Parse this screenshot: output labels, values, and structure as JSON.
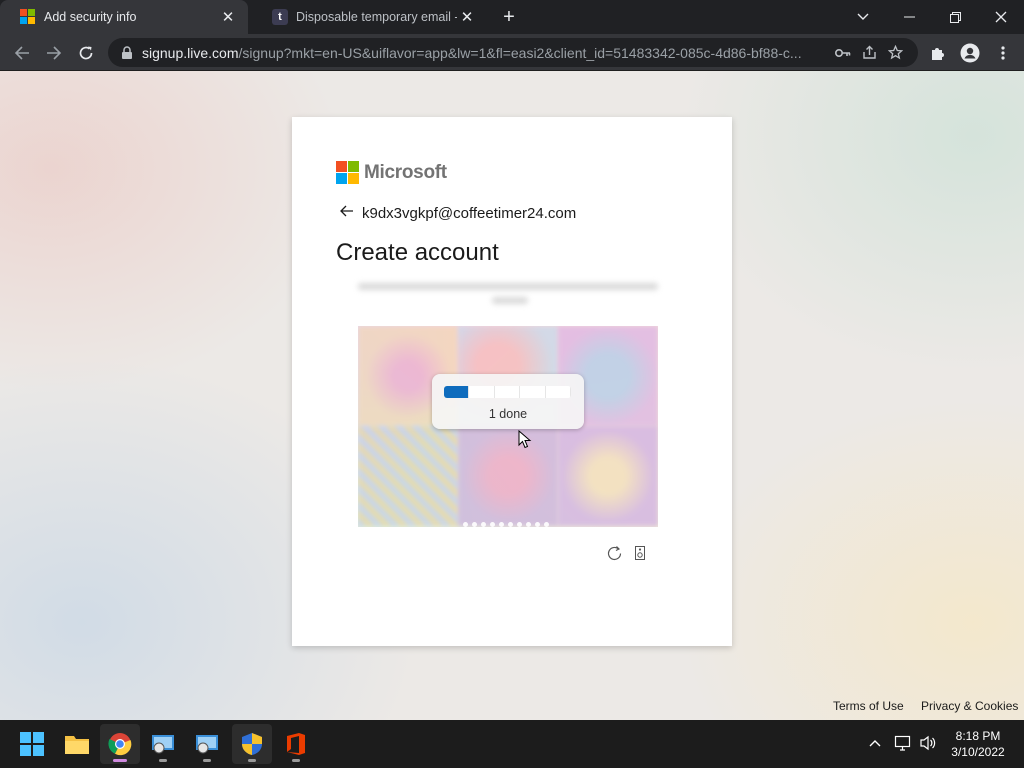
{
  "browser": {
    "tabs": [
      {
        "title": "Add security info",
        "favicon": "microsoft-icon",
        "active": true
      },
      {
        "title": "Disposable temporary email - Te",
        "favicon": "t-icon",
        "active": false
      }
    ],
    "url_host": "signup.live.com",
    "url_path": "/signup?mkt=en-US&uiflavor=app&lw=1&fl=easi2&client_id=51483342-085c-4d86-bf88-c..."
  },
  "card": {
    "brand": "Microsoft",
    "identity": "k9dx3vgkpf@coffeetimer24.com",
    "heading": "Create account",
    "puzzle": {
      "progress_total": 5,
      "progress_done": 1,
      "status": "1 done"
    }
  },
  "footer": {
    "terms": "Terms of Use",
    "privacy": "Privacy & Cookies"
  },
  "taskbar": {
    "time": "8:18 PM",
    "date": "3/10/2022"
  },
  "colors": {
    "progress_fill": "#0f6cbd",
    "chrome_dark": "#202124",
    "chrome_toolbar": "#35363a"
  }
}
